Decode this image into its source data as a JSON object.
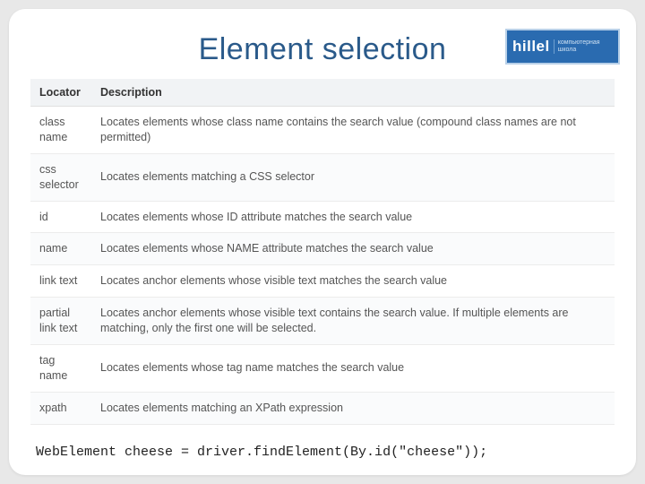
{
  "title": "Element selection",
  "logo": {
    "main": "hillel",
    "sub1": "компьютерная",
    "sub2": "школа"
  },
  "table": {
    "headers": [
      "Locator",
      "Description"
    ],
    "rows": [
      {
        "locator": "class name",
        "description": "Locates elements whose class name contains the search value (compound class names are not permitted)"
      },
      {
        "locator": "css selector",
        "description": "Locates elements matching a CSS selector"
      },
      {
        "locator": "id",
        "description": "Locates elements whose ID attribute matches the search value"
      },
      {
        "locator": "name",
        "description": "Locates elements whose NAME attribute matches the search value"
      },
      {
        "locator": "link text",
        "description": "Locates anchor elements whose visible text matches the search value"
      },
      {
        "locator": "partial link text",
        "description": "Locates anchor elements whose visible text contains the search value. If multiple elements are matching, only the first one will be selected."
      },
      {
        "locator": "tag name",
        "description": "Locates elements whose tag name matches the search value"
      },
      {
        "locator": "xpath",
        "description": "Locates elements matching an XPath expression"
      }
    ]
  },
  "code": "WebElement cheese = driver.findElement(By.id(\"cheese\"));"
}
